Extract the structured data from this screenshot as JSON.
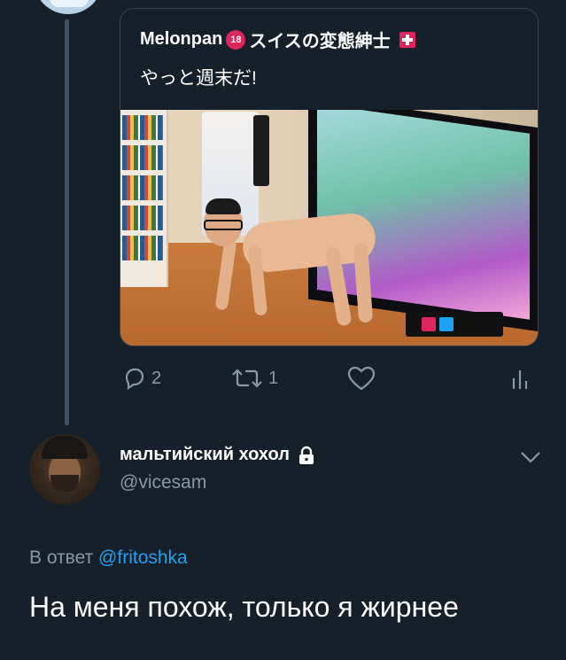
{
  "quoted_tweet": {
    "author_name": "Melonpan",
    "name_badge": "18",
    "author_name_suffix": "スイスの変態紳士",
    "text": "やっと週末だ!"
  },
  "actions": {
    "reply_count": "2",
    "retweet_count": "1"
  },
  "reply": {
    "display_name": "мальтийский хохол",
    "username": "@vicesam",
    "reply_to_prefix": "В ответ",
    "reply_to_mention": "@fritoshka",
    "text": "На меня похож, только я жирнее"
  },
  "icons": [
    "reply-icon",
    "retweet-icon",
    "like-icon",
    "analytics-icon",
    "lock-icon",
    "chevron-down-icon",
    "swiss-flag-icon"
  ],
  "colors": {
    "background": "#15202b",
    "muted_text": "#8899a6",
    "link": "#1da1f2",
    "border": "#38444d",
    "thread_line": "#3d5466"
  }
}
